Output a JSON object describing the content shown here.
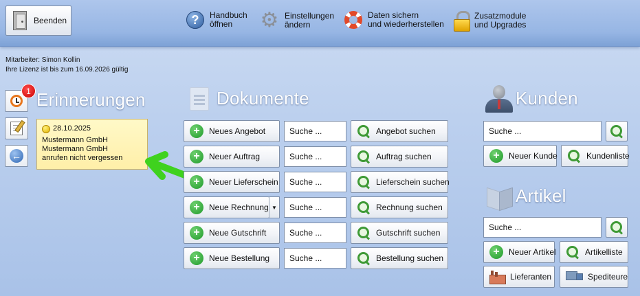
{
  "topbar": {
    "exit_label": "Beenden",
    "items": [
      {
        "line1": "Handbuch",
        "line2": "öffnen"
      },
      {
        "line1": "Einstellungen",
        "line2": "ändern"
      },
      {
        "line1": "Daten sichern",
        "line2": "und wiederherstellen"
      },
      {
        "line1": "Zusatzmodule",
        "line2": "und Upgrades"
      }
    ]
  },
  "info": {
    "employee": "Mitarbeiter: Simon Kollin",
    "license": "Ihre Lizenz ist bis zum 16.09.2026 gültig"
  },
  "reminders": {
    "title": "Erinnerungen",
    "badge_count": "1",
    "item": {
      "date": "28.10.2025",
      "line1": "Mustermann GmbH",
      "line2": "Mustermann GmbH",
      "line3": "anrufen nicht vergessen"
    }
  },
  "documents": {
    "title": "Dokumente",
    "search_placeholder": "Suche ...",
    "rows": [
      {
        "new_label": "Neues Angebot",
        "search_label": "Angebot suchen"
      },
      {
        "new_label": "Neuer Auftrag",
        "search_label": "Auftrag suchen"
      },
      {
        "new_label": "Neuer Lieferschein",
        "search_label": "Lieferschein suchen"
      },
      {
        "new_label": "Neue Rechnung",
        "search_label": "Rechnung suchen"
      },
      {
        "new_label": "Neue Gutschrift",
        "search_label": "Gutschrift suchen"
      },
      {
        "new_label": "Neue Bestellung",
        "search_label": "Bestellung suchen"
      }
    ],
    "dropdown_glyph": "▼"
  },
  "customers": {
    "title": "Kunden",
    "search_placeholder": "Suche ...",
    "new_label": "Neuer Kunde",
    "list_label": "Kundenliste"
  },
  "articles": {
    "title": "Artikel",
    "search_placeholder": "Suche ...",
    "new_label": "Neuer Artikel",
    "list_label": "Artikelliste",
    "suppliers_label": "Lieferanten",
    "forwarders_label": "Spediteure"
  },
  "colors": {
    "accent_arrow": "#3fd21e",
    "badge": "#d40000",
    "sticky": "#ffefa8"
  }
}
